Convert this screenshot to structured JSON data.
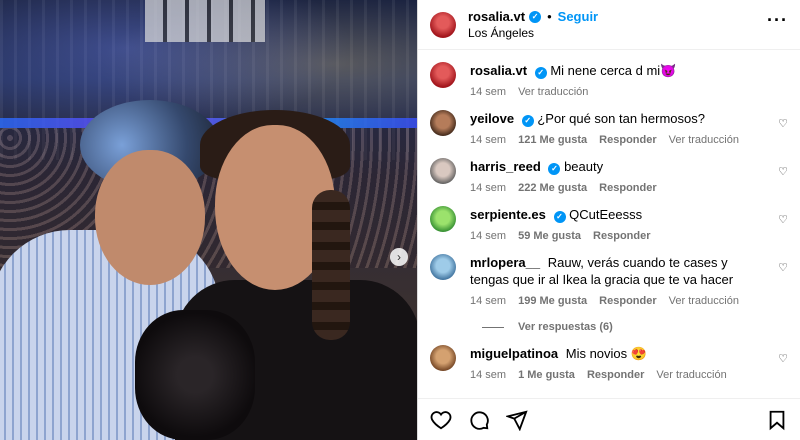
{
  "post": {
    "username": "rosalia.vt",
    "follow_label": "Seguir",
    "location": "Los Ángeles",
    "caption": {
      "username": "rosalia.vt",
      "text": "Mi nene cerca d mi😈",
      "time": "14 sem",
      "translate": "Ver traducción"
    }
  },
  "comments": [
    {
      "username": "yeilove",
      "verified": true,
      "text": "¿Por qué son tan hermosos?",
      "time": "14 sem",
      "likes": "121 Me gusta",
      "reply": "Responder",
      "translate": "Ver traducción"
    },
    {
      "username": "harris_reed",
      "verified": true,
      "text": "beauty",
      "time": "14 sem",
      "likes": "222 Me gusta",
      "reply": "Responder",
      "translate": ""
    },
    {
      "username": "serpiente.es",
      "verified": true,
      "text": "QCutEeesss",
      "time": "14 sem",
      "likes": "59 Me gusta",
      "reply": "Responder",
      "translate": ""
    },
    {
      "username": "mrlopera__",
      "verified": false,
      "text": "Rauw, verás cuando te cases y tengas que ir al Ikea la gracia que te va hacer",
      "time": "14 sem",
      "likes": "199 Me gusta",
      "reply": "Responder",
      "translate": "Ver traducción"
    },
    {
      "username": "miguelpatinoa",
      "verified": false,
      "text": "Mis novios 😍",
      "time": "14 sem",
      "likes": "1 Me gusta",
      "reply": "Responder",
      "translate": "Ver traducción"
    }
  ],
  "replies_label": "Ver respuestas (6)",
  "icons": {
    "more": "more-options-icon",
    "heart": "heart-icon",
    "comment": "comment-icon",
    "share": "share-icon",
    "save": "bookmark-icon",
    "verified": "verified-badge-icon",
    "carousel_next": "chevron-right-icon"
  },
  "colors": {
    "accent": "#0095f6",
    "muted": "#737373"
  }
}
